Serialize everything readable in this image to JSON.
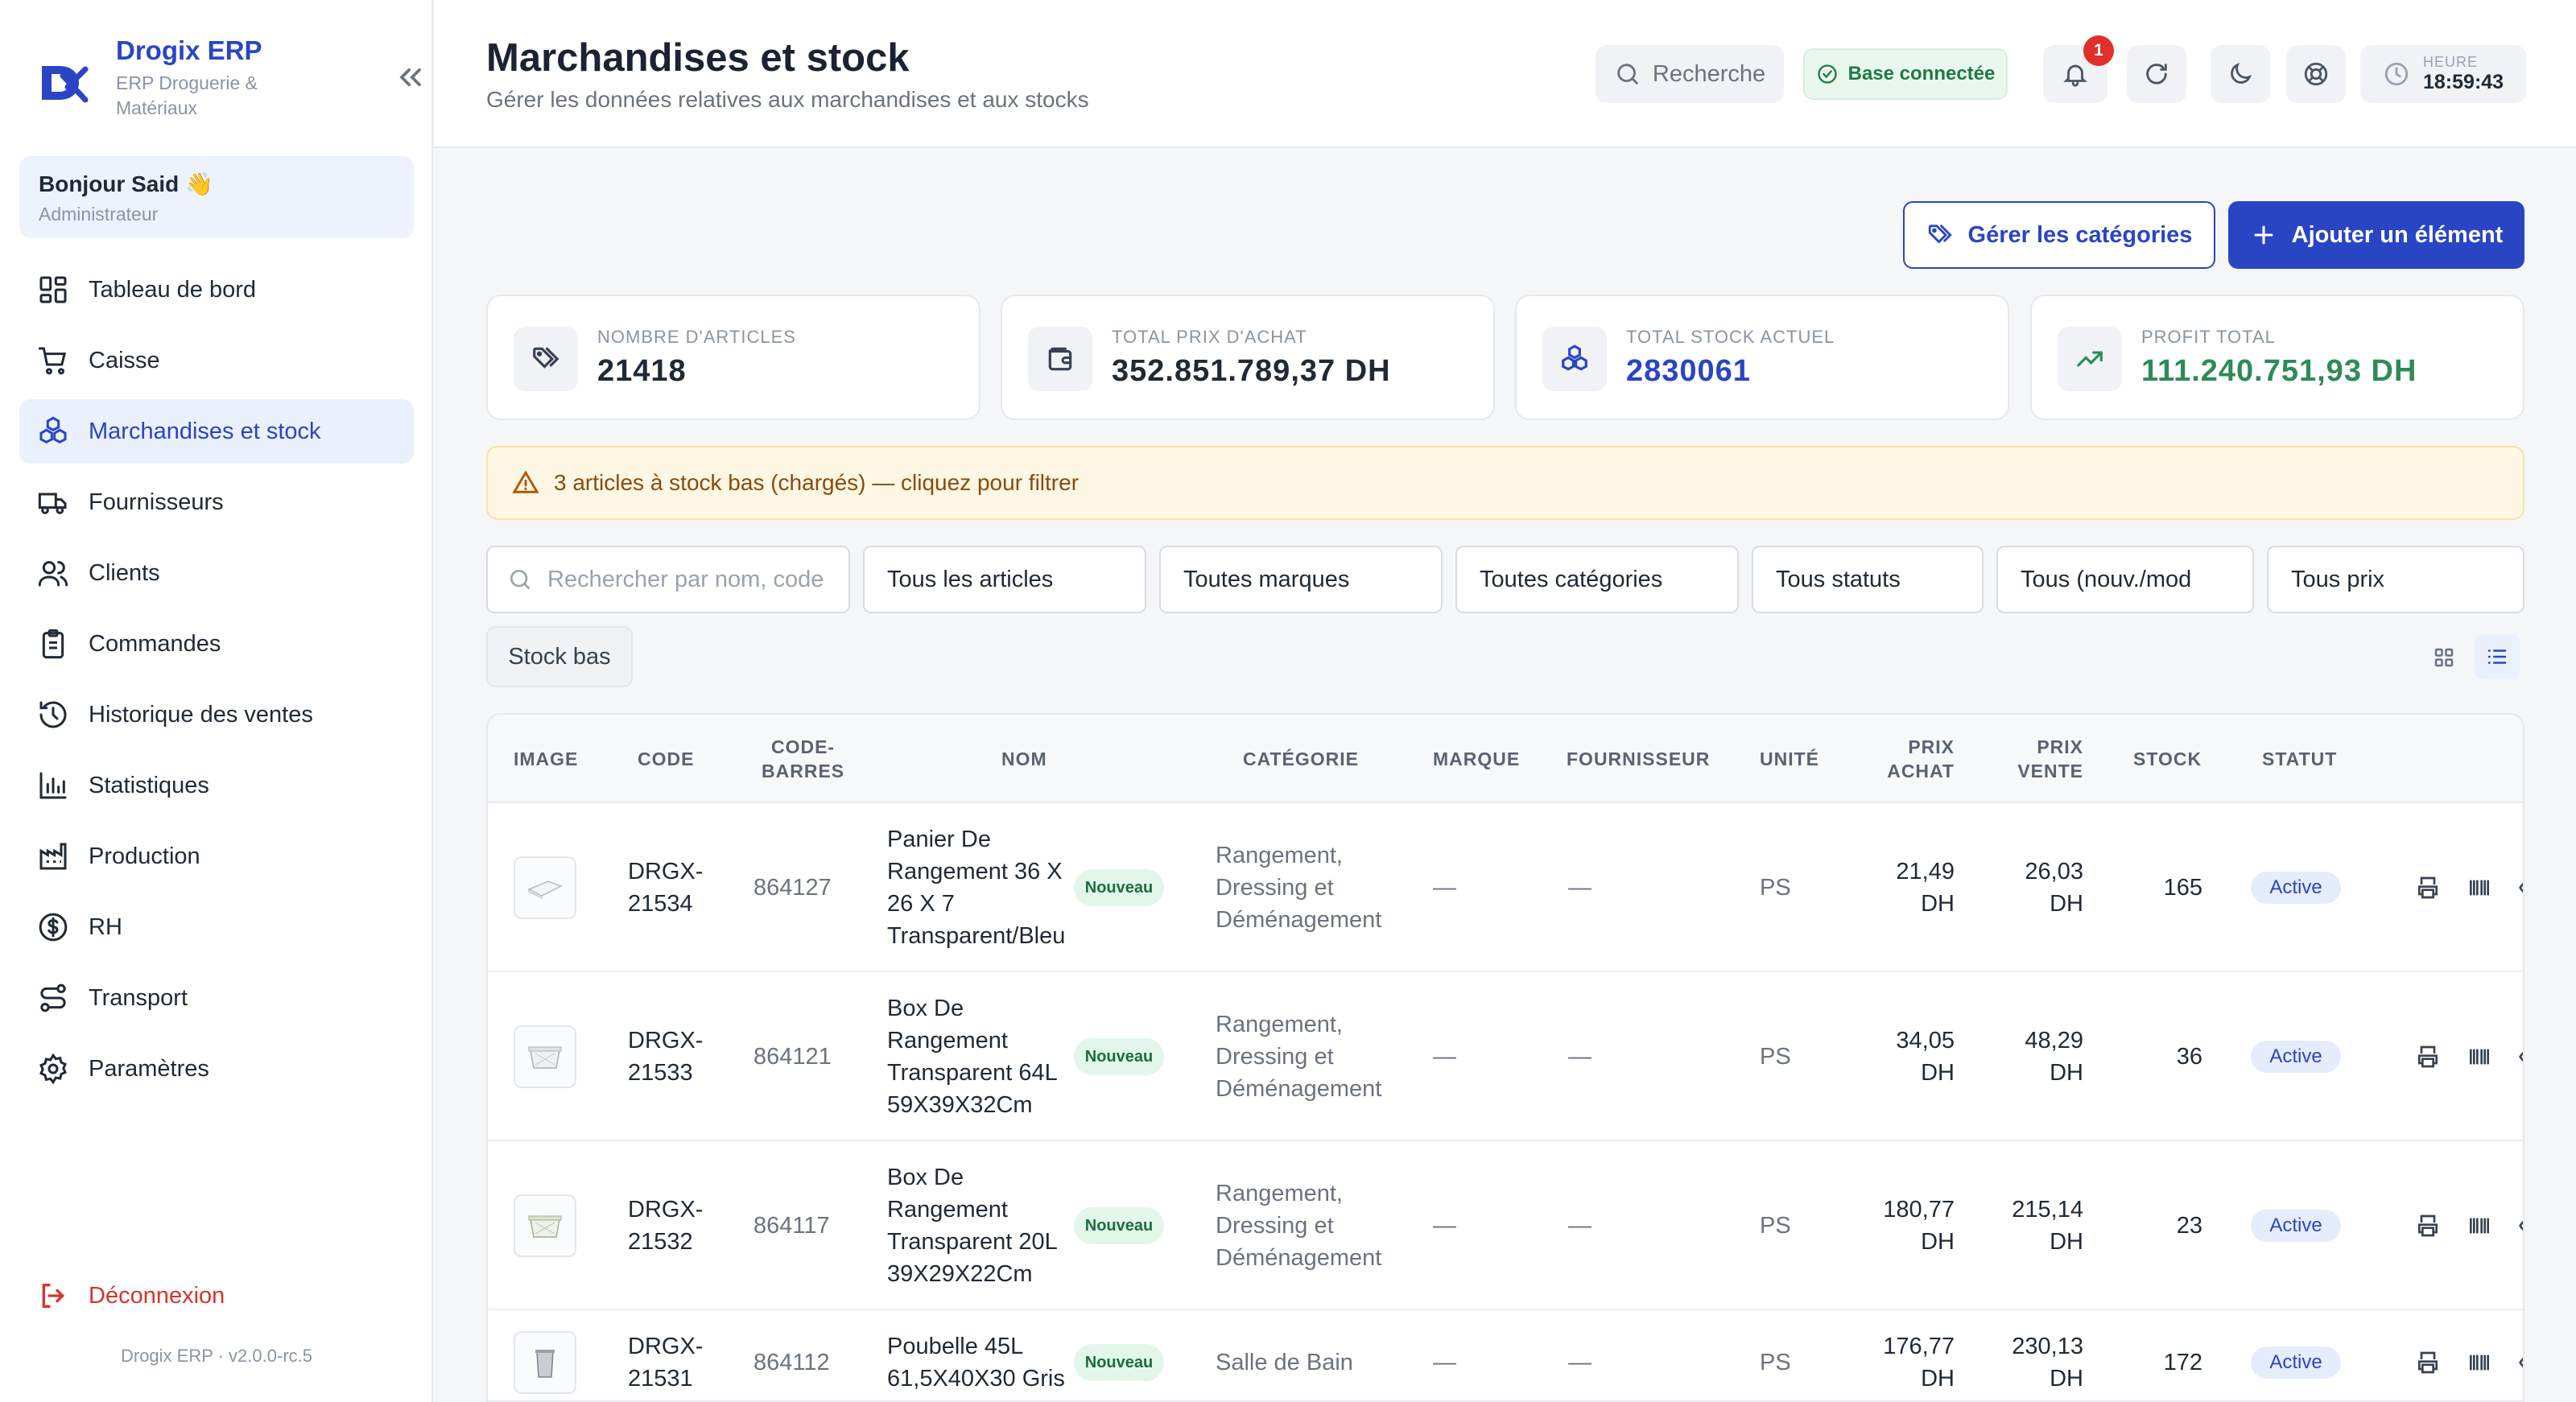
{
  "brand": {
    "title": "Drogix ERP",
    "subtitle": "ERP Droguerie & Matériaux",
    "logo_text": "DX"
  },
  "greeting": {
    "name": "Bonjour Said 👋",
    "role": "Administrateur"
  },
  "nav": [
    {
      "label": "Tableau de bord",
      "icon": "dashboard-icon"
    },
    {
      "label": "Caisse",
      "icon": "cart-icon"
    },
    {
      "label": "Marchandises et stock",
      "icon": "boxes-icon",
      "active": true
    },
    {
      "label": "Fournisseurs",
      "icon": "truck-icon"
    },
    {
      "label": "Clients",
      "icon": "users-icon"
    },
    {
      "label": "Commandes",
      "icon": "clipboard-icon"
    },
    {
      "label": "Historique des ventes",
      "icon": "history-icon"
    },
    {
      "label": "Statistiques",
      "icon": "bar-chart-icon"
    },
    {
      "label": "Production",
      "icon": "factory-icon"
    },
    {
      "label": "RH",
      "icon": "dollar-icon"
    },
    {
      "label": "Transport",
      "icon": "route-icon"
    },
    {
      "label": "Paramètres",
      "icon": "gear-icon"
    }
  ],
  "logout_label": "Déconnexion",
  "version": "Drogix ERP · v2.0.0-rc.5",
  "header": {
    "title": "Marchandises et stock",
    "subtitle": "Gérer les données relatives aux marchandises et aux stocks",
    "search_label": "Recherche",
    "db_status": "Base connectée",
    "notifications": "1",
    "time_label": "HEURE",
    "time_value": "18:59:43"
  },
  "actions": {
    "categories": "Gérer les catégories",
    "add": "Ajouter un élément"
  },
  "stats": [
    {
      "label": "Nombre d'articles",
      "value": "21418",
      "color": "#1f2937"
    },
    {
      "label": "Total prix d'achat",
      "value": "352.851.789,37 DH",
      "color": "#1f2937"
    },
    {
      "label": "Total stock actuel",
      "value": "2830061",
      "color": "#2a45c4"
    },
    {
      "label": "Profit total",
      "value": "111.240.751,93 DH",
      "color": "#2f8a57"
    }
  ],
  "alert": "3 articles à stock bas (chargés) — cliquez pour filtrer",
  "filters": {
    "search_placeholder": "Rechercher par nom, code",
    "articles": "Tous les articles",
    "brands": "Toutes marques",
    "categories": "Toutes catégories",
    "status": "Tous statuts",
    "newness": "Tous (nouv./mod",
    "prices": "Tous prix",
    "low_stock": "Stock bas"
  },
  "table": {
    "headers": [
      "Image",
      "Code",
      "Code-barres",
      "Nom",
      "Catégorie",
      "Marque",
      "Fournisseur",
      "Unité",
      "Prix achat",
      "Prix vente",
      "Stock",
      "Statut"
    ],
    "rows": [
      {
        "code": "DRGX-21534",
        "barcode": "864127",
        "name": "Panier De Rangement 36 X 26 X 7 Transparent/Bleu",
        "badge": "Nouveau",
        "category": "Rangement, Dressing et Déménagement",
        "brand": "—",
        "supplier": "—",
        "unit": "PS",
        "buy": "21,49 DH",
        "sell": "26,03 DH",
        "stock": "165",
        "status": "Active"
      },
      {
        "code": "DRGX-21533",
        "barcode": "864121",
        "name": "Box De Rangement Transparent 64L 59X39X32Cm",
        "badge": "Nouveau",
        "category": "Rangement, Dressing et Déménagement",
        "brand": "—",
        "supplier": "—",
        "unit": "PS",
        "buy": "34,05 DH",
        "sell": "48,29 DH",
        "stock": "36",
        "status": "Active"
      },
      {
        "code": "DRGX-21532",
        "barcode": "864117",
        "name": "Box De Rangement Transparent 20L 39X29X22Cm",
        "badge": "Nouveau",
        "category": "Rangement, Dressing et Déménagement",
        "brand": "—",
        "supplier": "—",
        "unit": "PS",
        "buy": "180,77 DH",
        "sell": "215,14 DH",
        "stock": "23",
        "status": "Active"
      },
      {
        "code": "DRGX-21531",
        "barcode": "864112",
        "name": "Poubelle 45L 61,5X40X30 Gris",
        "badge": "Nouveau",
        "category": "Salle de Bain",
        "brand": "—",
        "supplier": "—",
        "unit": "PS",
        "buy": "176,77 DH",
        "sell": "230,13 DH",
        "stock": "172",
        "status": "Active"
      }
    ]
  }
}
